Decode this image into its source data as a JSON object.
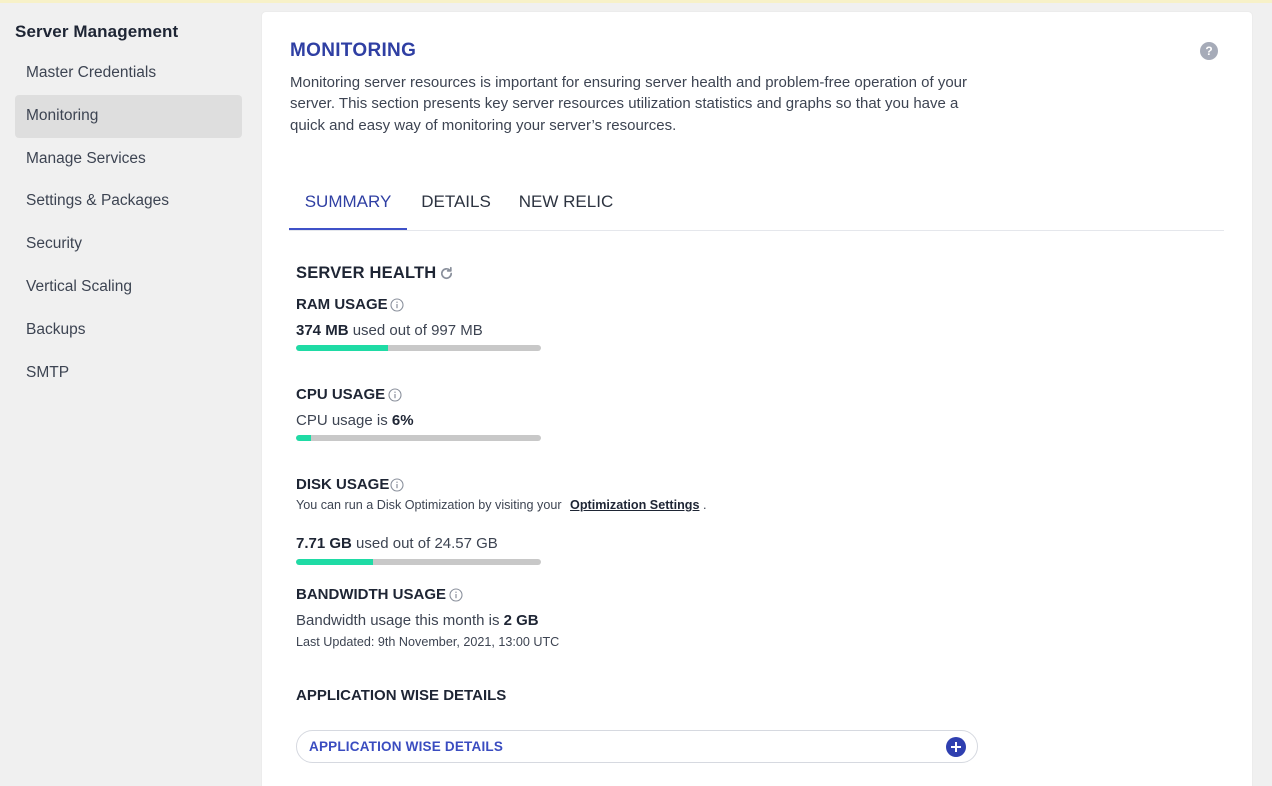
{
  "sidebar": {
    "title": "Server Management",
    "items": [
      {
        "label": "Master Credentials",
        "active": false
      },
      {
        "label": "Monitoring",
        "active": true
      },
      {
        "label": "Manage Services",
        "active": false
      },
      {
        "label": "Settings & Packages",
        "active": false
      },
      {
        "label": "Security",
        "active": false
      },
      {
        "label": "Vertical Scaling",
        "active": false
      },
      {
        "label": "Backups",
        "active": false
      },
      {
        "label": "SMTP",
        "active": false
      }
    ]
  },
  "header": {
    "title": "MONITORING",
    "help_icon": "question-circle-icon",
    "help_glyph": "?",
    "description": "Monitoring server resources is important for ensuring server health and problem-free operation of your server. This section presents key server resources utilization statistics and graphs so that you have a quick and easy way of monitoring your server’s resources."
  },
  "tabs": [
    {
      "label": "SUMMARY",
      "active": true
    },
    {
      "label": "DETAILS",
      "active": false
    },
    {
      "label": "NEW RELIC",
      "active": false
    }
  ],
  "server_health": {
    "title": "SERVER HEALTH",
    "refresh_icon": "refresh-icon",
    "ram": {
      "label": "RAM USAGE",
      "used": "374 MB",
      "text": "used out of 997 MB",
      "fraction": 0.375
    },
    "cpu": {
      "label": "CPU USAGE",
      "text": "CPU usage is",
      "value": "6%",
      "fraction": 0.06
    },
    "disk": {
      "label": "DISK USAGE",
      "note": "You can run a Disk Optimization by visiting your",
      "link": "Optimization Settings",
      "note_end": ".",
      "used": "7.71 GB",
      "text": "used out of 24.57 GB",
      "fraction": 0.314
    },
    "bandwidth": {
      "label": "BANDWIDTH USAGE",
      "text": "Bandwidth usage this month is",
      "value": "2 GB",
      "updated": "Last Updated: 9th November, 2021, 13:00 UTC"
    }
  },
  "application": {
    "title": "APPLICATION WISE DETAILS",
    "accordion_label": "APPLICATION WISE DETAILS",
    "expand_icon": "plus-circle-icon"
  },
  "colors": {
    "accent": "#2f3fa3",
    "bar_fill": "#1fdba5",
    "bar_track": "#c8c8c8",
    "active_nav_bg": "#dedede"
  }
}
